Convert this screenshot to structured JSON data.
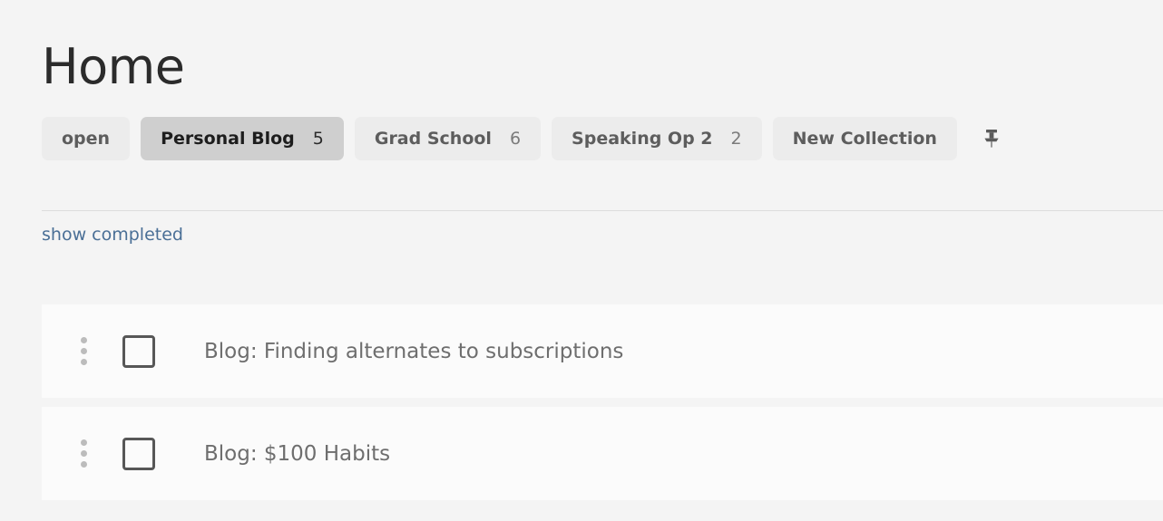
{
  "header": {
    "title": "Home"
  },
  "collections": {
    "chips": [
      {
        "label": "open",
        "count": "",
        "active": false
      },
      {
        "label": "Personal Blog",
        "count": "5",
        "active": true
      },
      {
        "label": "Grad School",
        "count": "6",
        "active": false
      },
      {
        "label": "Speaking Op 2",
        "count": "2",
        "active": false
      },
      {
        "label": "New Collection",
        "count": "",
        "active": false
      }
    ],
    "pin_icon": "pin-icon"
  },
  "filters": {
    "show_completed_label": "show completed"
  },
  "tasks": {
    "items": [
      {
        "title": "Blog: Finding alternates to subscriptions",
        "checked": false,
        "handle_icon": "drag-handle-icon",
        "checkbox_icon": "checkbox-unchecked-icon"
      },
      {
        "title": "Blog: $100 Habits",
        "checked": false,
        "handle_icon": "drag-handle-icon",
        "checkbox_icon": "checkbox-unchecked-icon"
      }
    ]
  },
  "colors": {
    "page_background": "#f4f4f4",
    "chip_background": "#ececec",
    "chip_active_background": "#cfcfcf",
    "link": "#4a6f96",
    "card_background": "#fbfbfb",
    "task_text": "#6e6e6e",
    "checkbox_border": "#575757"
  }
}
